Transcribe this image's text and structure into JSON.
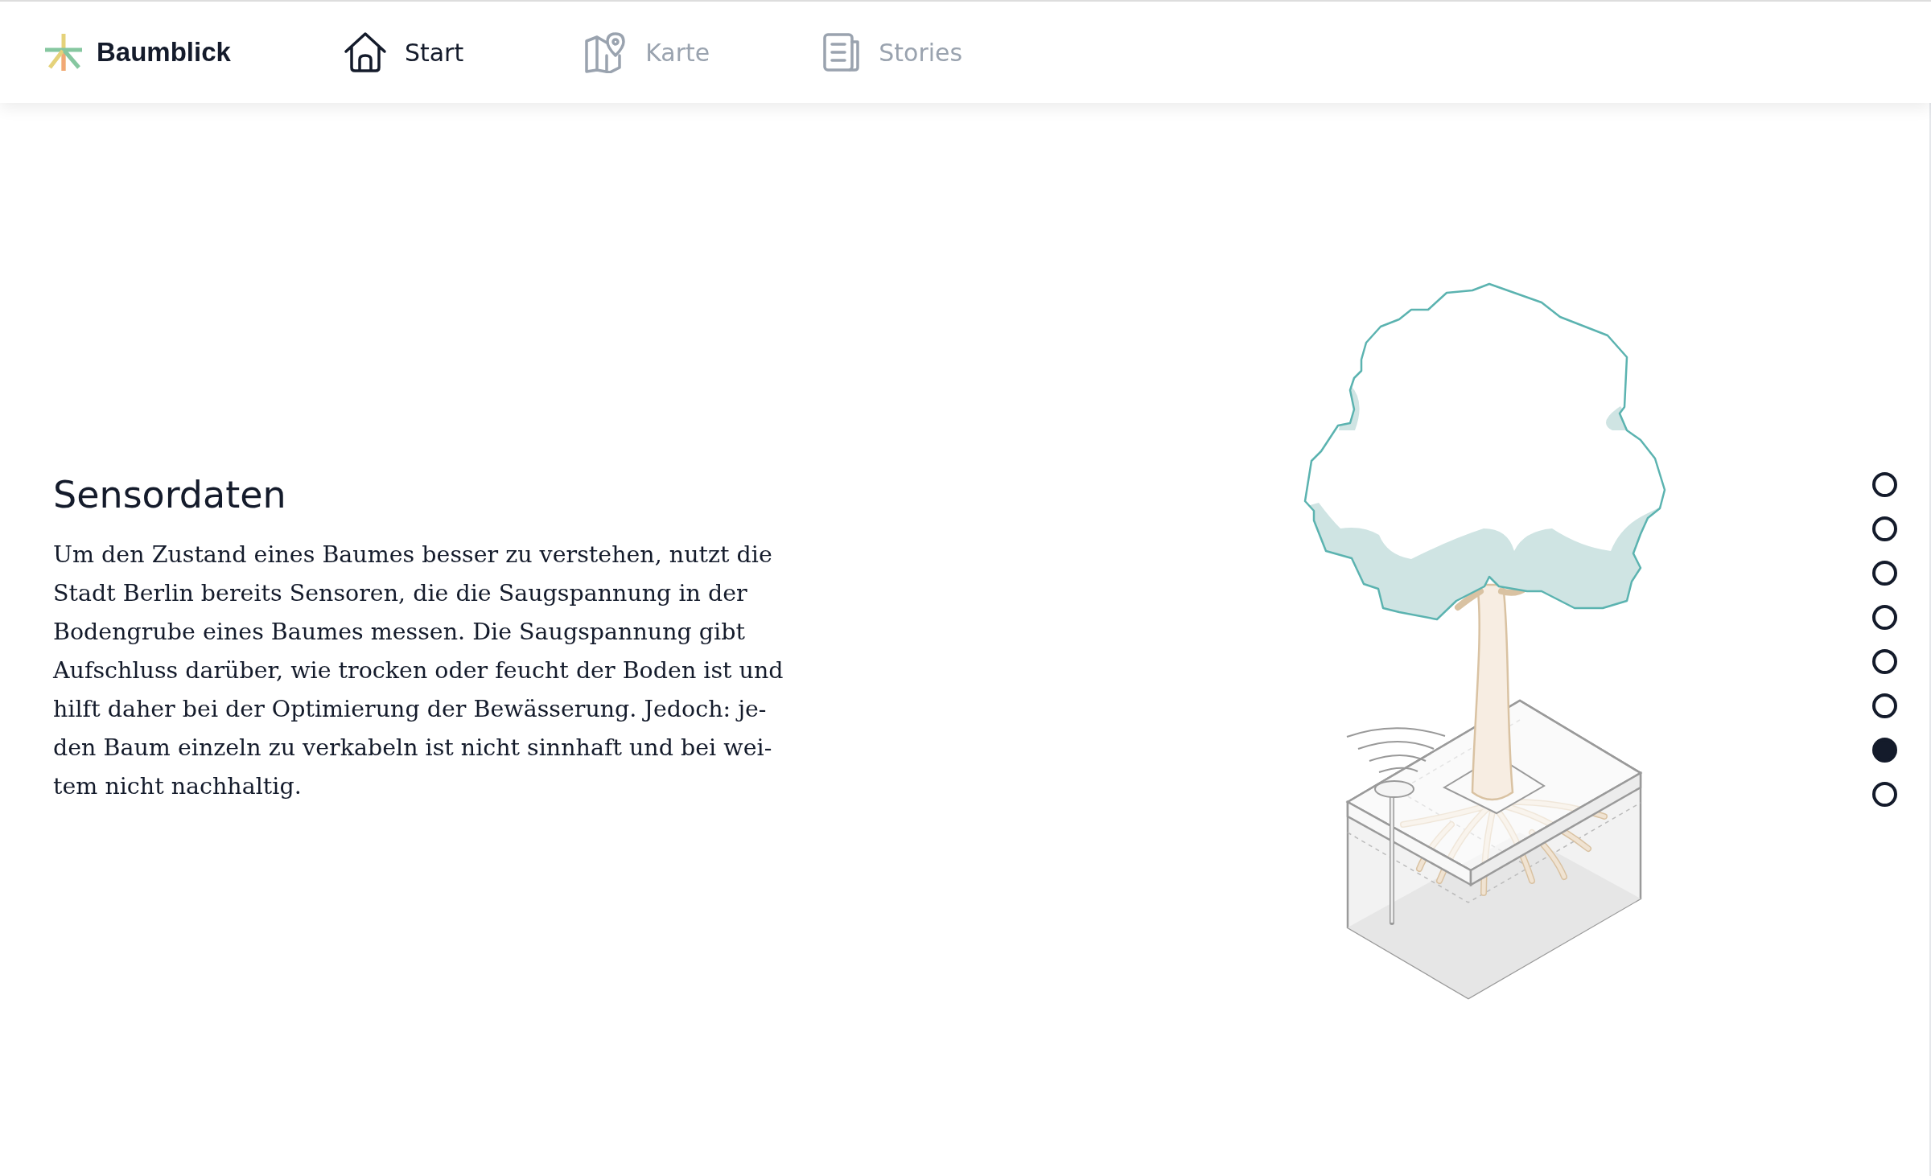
{
  "brand": {
    "name": "Baumblick"
  },
  "nav": [
    {
      "label": "Start",
      "selected": true
    },
    {
      "label": "Karte",
      "selected": false
    },
    {
      "label": "Stories",
      "selected": false
    }
  ],
  "section": {
    "title": "Sensordaten",
    "paragraph_lines": [
      "Um den Zustand eines Baumes besser zu verstehen, nutzt die",
      "Stadt Berlin bereits Sensoren, die die Saugspannung in der",
      "Bodengrube eines Baumes messen. Die Saugspannung gibt",
      "Aufschluss darüber, wie trocken oder feucht der Boden ist und",
      "hilft daher bei der Optimierung der Bewässerung. Jedoch: je-",
      "den Baum einzeln zu verkabeln ist nicht sinnhaft und bei wei-",
      "tem nicht nachhaltig."
    ]
  },
  "steps": [
    {
      "selected": false
    },
    {
      "selected": false
    },
    {
      "selected": false
    },
    {
      "selected": false
    },
    {
      "selected": false
    },
    {
      "selected": false
    },
    {
      "selected": true
    },
    {
      "selected": false
    }
  ]
}
